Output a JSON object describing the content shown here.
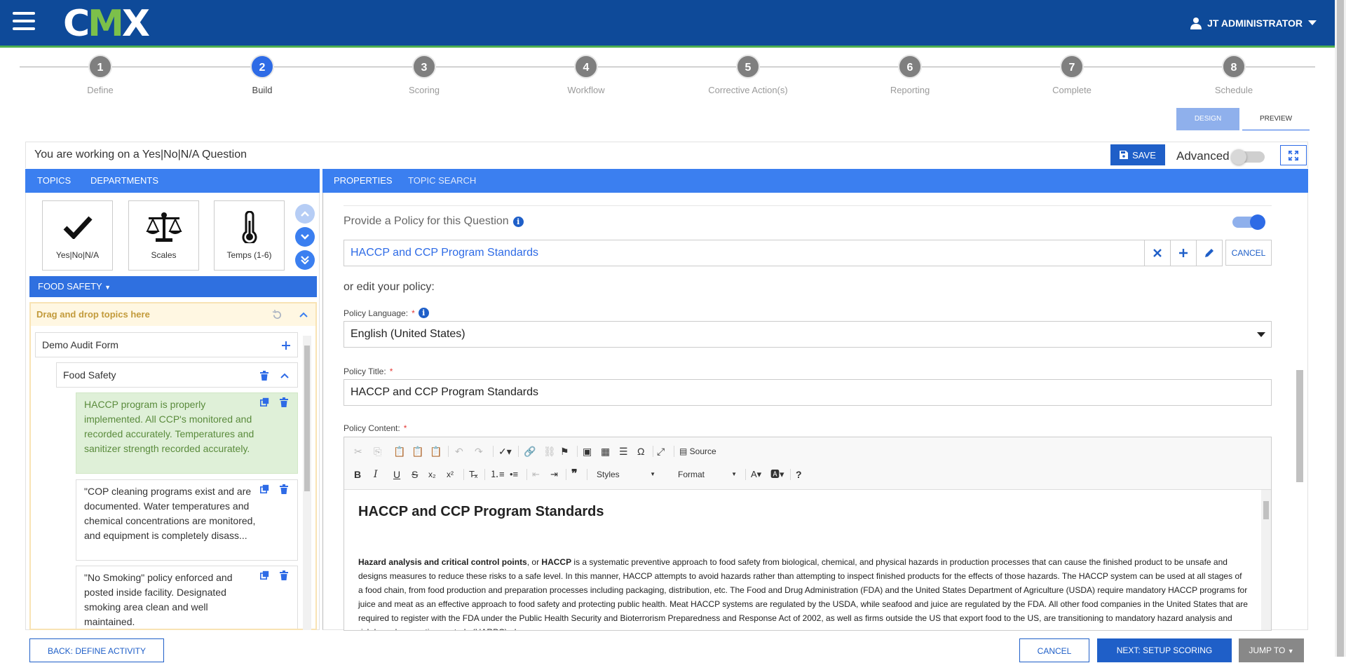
{
  "header": {
    "logo_prefix": "C",
    "logo_m": "M",
    "logo_suffix": "X",
    "user": "JT ADMINISTRATOR",
    "brand_color": "#0e4a99",
    "accent_color": "#4caf50"
  },
  "steps": [
    {
      "num": "1",
      "label": "Define",
      "active": false
    },
    {
      "num": "2",
      "label": "Build",
      "active": true
    },
    {
      "num": "3",
      "label": "Scoring",
      "active": false
    },
    {
      "num": "4",
      "label": "Workflow",
      "active": false
    },
    {
      "num": "5",
      "label": "Corrective Action(s)",
      "active": false
    },
    {
      "num": "6",
      "label": "Reporting",
      "active": false
    },
    {
      "num": "7",
      "label": "Complete",
      "active": false
    },
    {
      "num": "8",
      "label": "Schedule",
      "active": false
    }
  ],
  "view_toggle": {
    "design": "DESIGN",
    "preview": "PREVIEW",
    "selected": "design"
  },
  "working": {
    "text": "You are working on a Yes|No|N/A Question",
    "save": "SAVE",
    "advanced": "Advanced",
    "advanced_on": false
  },
  "left_tabs": {
    "topics": "TOPICS",
    "departments": "DEPARTMENTS"
  },
  "topic_cards": [
    {
      "label": "Yes|No|N/A",
      "icon": "checkmark-icon"
    },
    {
      "label": "Scales",
      "icon": "scales-icon"
    },
    {
      "label": "Temps (1-6)",
      "icon": "thermometer-icon"
    }
  ],
  "category_button": "FOOD SAFETY",
  "dropzone": {
    "title": "Drag and drop topics here",
    "form": "Demo Audit Form",
    "section": "Food Safety",
    "questions": [
      {
        "text": "HACCP program is properly implemented. All CCP's monitored and recorded accurately. Temperatures and sanitizer strength recorded accurately.",
        "selected": true
      },
      {
        "text": "\"COP cleaning programs exist and are documented. Water temperatures and chemical concentrations are monitored, and equipment is completely disass...",
        "selected": false
      },
      {
        "text": "\"No Smoking\" policy enforced and posted inside facility. Designated smoking area clean and well maintained.",
        "selected": false
      }
    ]
  },
  "right_tabs": {
    "properties": "PROPERTIES",
    "topic_search": "TOPIC SEARCH"
  },
  "policy": {
    "label": "Provide a Policy for this Question",
    "enabled": true,
    "selected": "HACCP and CCP Program Standards",
    "cancel": "CANCEL",
    "or_edit": "or edit your policy:",
    "language_label": "Policy Language:",
    "language": "English (United States)",
    "title_label": "Policy Title:",
    "title": "HACCP and CCP Program Standards",
    "content_label": "Policy Content:",
    "required_mark": "*"
  },
  "editor": {
    "source": "Source",
    "styles": "Styles",
    "format": "Format",
    "heading": "HACCP and CCP Program Standards",
    "para_bold1": "Hazard analysis and critical control points",
    "para_mid1": ", or ",
    "para_bold2": "HACCP",
    "para_rest": " is a systematic preventive approach to food safety from biological, chemical, and physical hazards in production processes that can cause the finished product to be unsafe and designs measures to reduce these risks to a safe level. In this manner, HACCP attempts to avoid hazards rather than attempting to inspect finished products for the effects of those hazards. The HACCP system can be used at all stages of a food chain, from food production and preparation processes including packaging, distribution, etc. The Food and Drug Administration (FDA) and the United States Department of Agriculture (USDA) require mandatory HACCP programs for juice and meat as an effective approach to food safety and protecting public health. Meat HACCP systems are regulated by the USDA, while seafood and juice are regulated by the FDA. All other food companies in the United States that are required to register with the FDA under the Public Health Security and Bioterrorism Preparedness and Response Act of 2002, as well as firms outside the US that export food to the US, are transitioning to mandatory hazard analysis and risk-based preventive controls (HARPC) plans."
  },
  "footer": {
    "back": "BACK: DEFINE ACTIVITY",
    "cancel": "CANCEL",
    "next": "NEXT: SETUP SCORING",
    "jump": "JUMP TO"
  }
}
